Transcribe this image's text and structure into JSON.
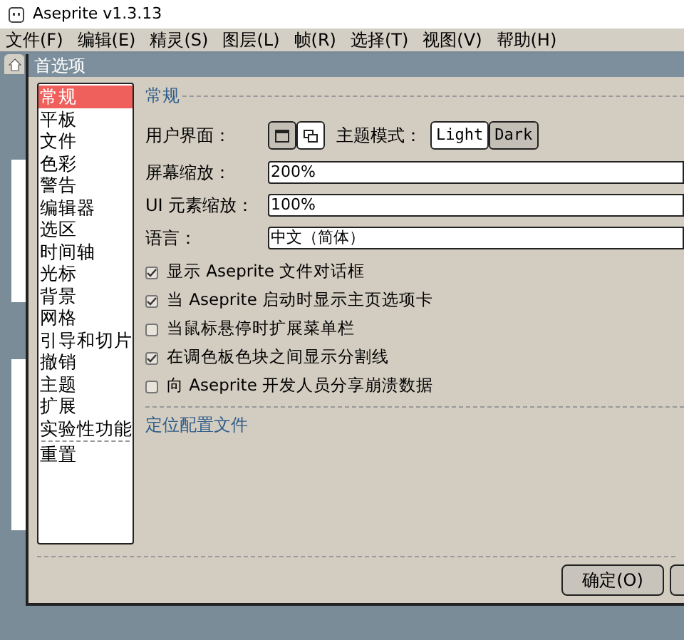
{
  "window": {
    "title": "Aseprite v1.3.13"
  },
  "menu": [
    "文件(F)",
    "编辑(E)",
    "精灵(S)",
    "图层(L)",
    "帧(R)",
    "选择(T)",
    "视图(V)",
    "帮助(H)"
  ],
  "dialog": {
    "title": "首选项",
    "sections": [
      {
        "label": "常规",
        "selected": true
      },
      {
        "label": "平板",
        "selected": false
      },
      {
        "label": "文件",
        "selected": false
      },
      {
        "label": "色彩",
        "selected": false
      },
      {
        "label": "警告",
        "selected": false
      },
      {
        "label": "编辑器",
        "selected": false
      },
      {
        "label": "选区",
        "selected": false
      },
      {
        "label": "时间轴",
        "selected": false
      },
      {
        "label": "光标",
        "selected": false
      },
      {
        "label": "背景",
        "selected": false
      },
      {
        "label": "网格",
        "selected": false
      },
      {
        "label": "引导和切片",
        "selected": false
      },
      {
        "label": "撤销",
        "selected": false
      },
      {
        "label": "主题",
        "selected": false
      },
      {
        "label": "扩展",
        "selected": false
      },
      {
        "label": "实验性功能",
        "selected": false
      }
    ],
    "reset": "重置",
    "heading": "常规",
    "ui_label": "用户界面：",
    "ui_modes": [
      {
        "kind": "single",
        "selected": true
      },
      {
        "kind": "multi",
        "selected": false
      }
    ],
    "theme_label": "主题模式：",
    "themes": [
      {
        "label": "Light",
        "selected": false
      },
      {
        "label": "Dark",
        "selected": true
      }
    ],
    "fields": [
      {
        "label": "屏幕缩放：",
        "value": "200%"
      },
      {
        "label": "UI 元素缩放：",
        "value": "100%"
      },
      {
        "label": "语言：",
        "value": "中文（简体）"
      }
    ],
    "options": [
      {
        "label": "显示 Aseprite 文件对话框",
        "checked": true
      },
      {
        "label": "当 Aseprite 启动时显示主页选项卡",
        "checked": true
      },
      {
        "label": "当鼠标悬停时扩展菜单栏",
        "checked": false
      },
      {
        "label": "在调色板色块之间显示分割线",
        "checked": true
      },
      {
        "label": "向 Aseprite 开发人员分享崩溃数据",
        "checked": false
      }
    ],
    "link": "定位配置文件",
    "ok": "确定(O)"
  }
}
